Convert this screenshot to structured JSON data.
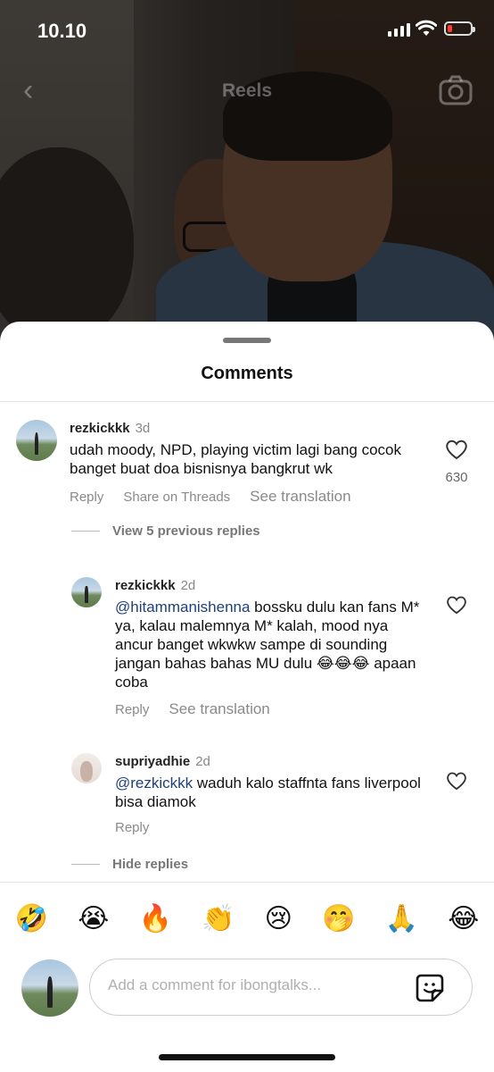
{
  "status": {
    "time": "10.10"
  },
  "topbar": {
    "title": "Reels"
  },
  "sheet": {
    "title": "Comments"
  },
  "comments": [
    {
      "username": "rezkickkk",
      "age": "3d",
      "text": "udah moody, NPD, playing victim lagi bang cocok banget buat doa bisnisnya bangkrut wk",
      "reply": "Reply",
      "share": "Share on Threads",
      "translate": "See translation",
      "likes": "630",
      "view_previous": "View 5 previous replies"
    }
  ],
  "replies": [
    {
      "username": "rezkickkk",
      "age": "2d",
      "mention": "@hitammanishenna",
      "text": " bossku dulu kan fans M* ya, kalau malemnya M* kalah, mood nya ancur banget wkwkw sampe di sounding jangan bahas bahas MU dulu 😂😂😂 apaan coba",
      "reply": "Reply",
      "translate": "See translation"
    },
    {
      "username": "supriyadhie",
      "age": "2d",
      "mention": "@rezkickkk",
      "text": " waduh kalo staffnta fans liverpool bisa diamok",
      "reply": "Reply"
    }
  ],
  "hide_replies": "Hide replies",
  "emojis": [
    "🤣",
    "😭",
    "🔥",
    "👏",
    "😢",
    "🤭",
    "🙏",
    "😂"
  ],
  "composer": {
    "placeholder": "Add a comment for ibongtalks..."
  }
}
